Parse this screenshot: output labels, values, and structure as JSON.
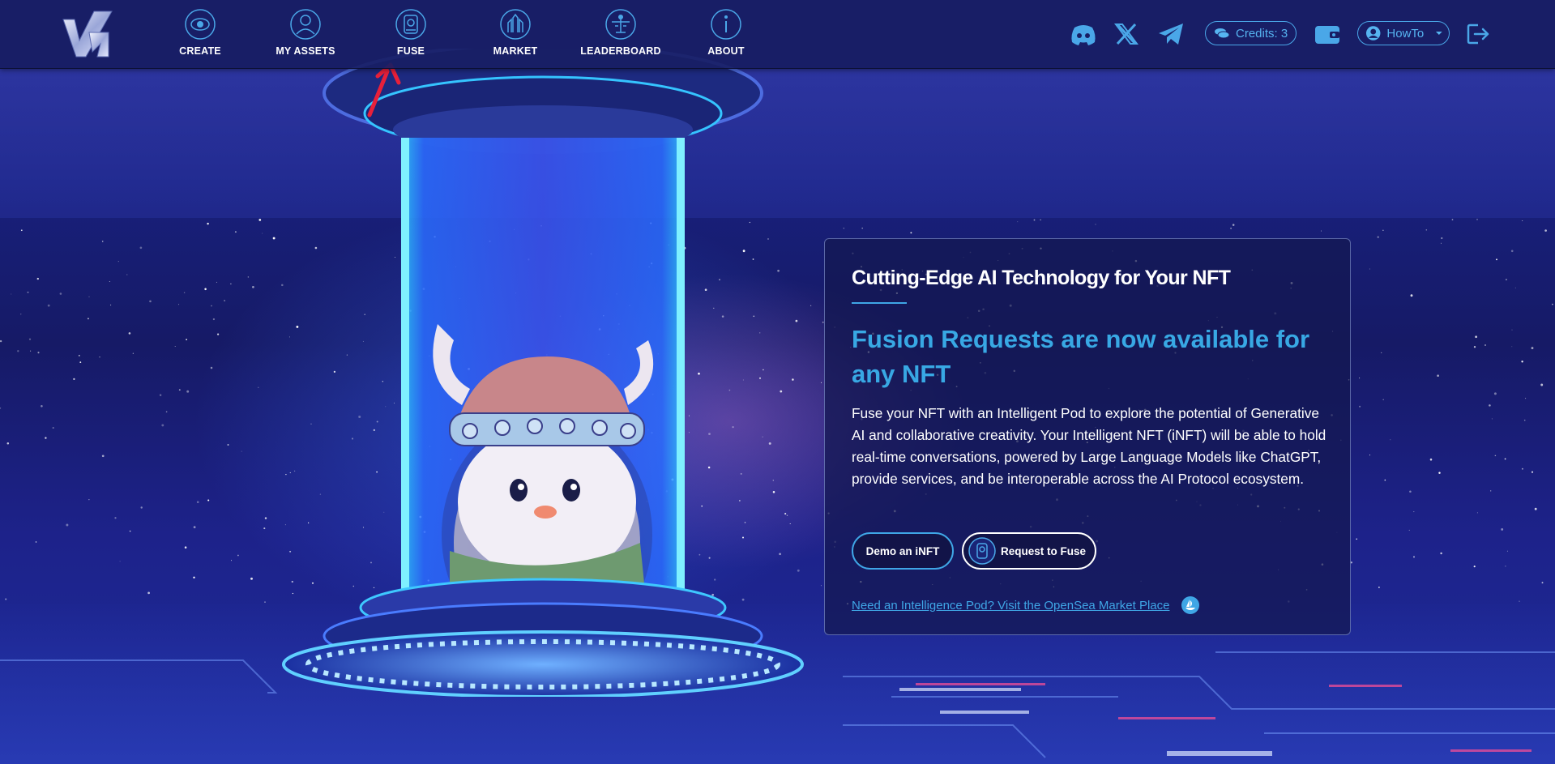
{
  "nav": {
    "items": [
      {
        "label": "CREATE",
        "icon": "create-icon"
      },
      {
        "label": "MY ASSETS",
        "icon": "user-icon"
      },
      {
        "label": "FUSE",
        "icon": "fuse-pod-icon"
      },
      {
        "label": "MARKET",
        "icon": "market-icon"
      },
      {
        "label": "LEADERBOARD",
        "icon": "leaderboard-icon"
      },
      {
        "label": "ABOUT",
        "icon": "info-icon"
      }
    ],
    "credits_label": "Credits: 3",
    "user_menu_label": "HowTo",
    "social": [
      "discord-icon",
      "x-icon",
      "telegram-icon"
    ]
  },
  "card": {
    "kicker": "Cutting-Edge AI Technology for Your NFT",
    "headline": "Fusion Requests are now available for any NFT",
    "body": "Fuse your NFT with an Intelligent Pod to explore the potential of Generative AI and collaborative creativity. Your Intelligent NFT (iNFT) will be able to hold real-time conversations, powered by Large Language Models like ChatGPT, provide services, and be interoperable across the AI Protocol ecosystem.",
    "demo_button": "Demo an iNFT",
    "fuse_button": "Request to Fuse",
    "market_link": "Need an Intelligence Pod? Visit the OpenSea Market Place"
  },
  "colors": {
    "accent": "#3fa6e6",
    "navbar": "#181e64",
    "background": "#161a66",
    "annotation": "#e8203a"
  }
}
